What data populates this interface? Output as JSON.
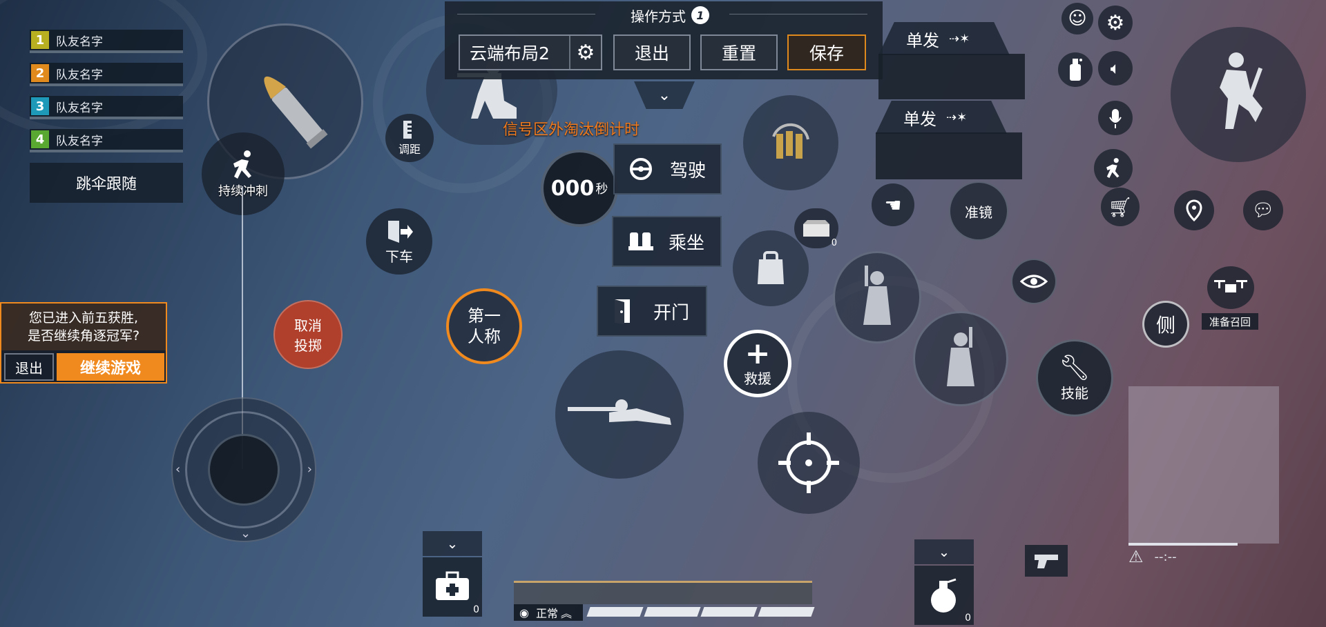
{
  "squad": {
    "members": [
      {
        "num": "1",
        "name": "队友名字",
        "color": "#b8b020"
      },
      {
        "num": "2",
        "name": "队友名字",
        "color": "#e08a1e"
      },
      {
        "num": "3",
        "name": "队友名字",
        "color": "#1e9ab8"
      },
      {
        "num": "4",
        "name": "队友名字",
        "color": "#58a832"
      }
    ],
    "parachute_follow": "跳伞跟随"
  },
  "top_panel": {
    "title": "操作方式",
    "badge": "1",
    "layout_name": "云端布局2",
    "exit": "退出",
    "reset": "重置",
    "save": "保存"
  },
  "signal_countdown": "信号区外淘汰倒计时",
  "timer": {
    "value": "000",
    "unit": "秒"
  },
  "fire_mode": {
    "top": "单发",
    "bottom": "单发"
  },
  "buttons": {
    "sprint": "持续冲刺",
    "adjust": "调距",
    "exit_vehicle": "下车",
    "cancel_throw_1": "取消",
    "cancel_throw_2": "投掷",
    "first_person_1": "第一",
    "first_person_2": "人称",
    "drive": "驾驶",
    "ride": "乘坐",
    "open_door": "开门",
    "rescue": "救援",
    "scope": "准镜",
    "skill": "技能",
    "lean": "侧",
    "drone_recall": "准备召回",
    "box_count": "0",
    "medkit_count": "0",
    "grenade_count": "0"
  },
  "top5_prompt": {
    "line1": "您已进入前五获胜,",
    "line2": "是否继续角逐冠军?",
    "exit": "退出",
    "continue": "继续游戏"
  },
  "status": {
    "stance": "正常",
    "minimap_time": "--:--"
  },
  "colors": {
    "accent_orange": "#f08a1e",
    "cancel_red": "#b0402c",
    "warning_orange": "#f07a1e"
  }
}
